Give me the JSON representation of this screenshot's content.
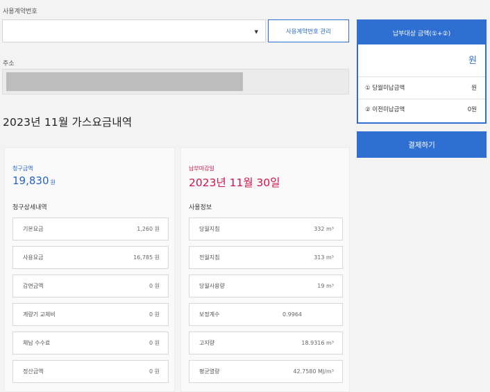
{
  "contract": {
    "label": "사용계약번호",
    "select_value": "",
    "arrow": "▼",
    "manage_label": "사용계약번호 관리"
  },
  "address": {
    "label": "주소"
  },
  "month_title": "2023년 11월 가스요금내역",
  "bill": {
    "amount_label": "청구금액",
    "amount": "19,830",
    "amount_unit": "원",
    "detail_title": "청구상세내역",
    "rows": [
      {
        "label": "기본요금",
        "value": "1,260 원"
      },
      {
        "label": "사용요금",
        "value": "16,785 원"
      },
      {
        "label": "감면금액",
        "value": "0 원"
      },
      {
        "label": "계량기 교체비",
        "value": "0 원"
      },
      {
        "label": "체납 수수료",
        "value": "0 원"
      },
      {
        "label": "정산금액",
        "value": "0 원"
      }
    ]
  },
  "usage": {
    "due_label": "납부마감일",
    "due_date": "2023년 11월 30일",
    "info_title": "사용정보",
    "rows": [
      {
        "label": "당월지침",
        "value": "332 m³"
      },
      {
        "label": "전월지침",
        "value": "313 m³"
      },
      {
        "label": "당월사용량",
        "value": "19 m³"
      },
      {
        "label": "보정계수",
        "value": "0.9964"
      },
      {
        "label": "고지량",
        "value": "18.9316 m³"
      },
      {
        "label": "평균열량",
        "value": "42.7580 MJ/m³"
      }
    ]
  },
  "side": {
    "title": "납부대상 금액(①+②)",
    "won": "원",
    "item1_label": "① 당월미납금액",
    "item1_value": "원",
    "item2_label": "② 이전미납금액",
    "item2_value": "0원"
  },
  "pay_button": "결제하기",
  "colors": {
    "accent": "#2f6fd1",
    "amount_blue": "#2462c8",
    "due_red": "#d2144c"
  }
}
